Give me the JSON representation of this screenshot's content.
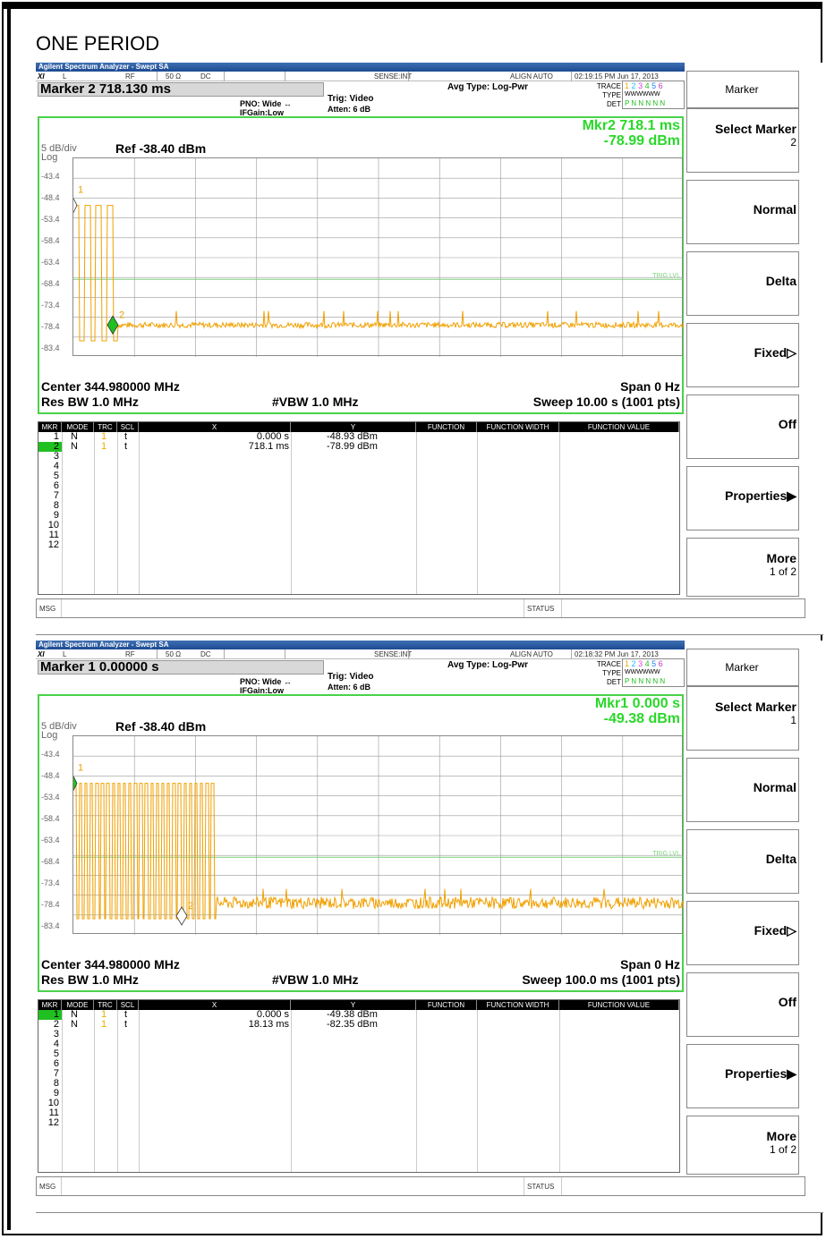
{
  "page_title": "ONE PERIOD",
  "screens": [
    {
      "titlebar": "Agilent Spectrum Analyzer - Swept SA",
      "status": {
        "l": "L",
        "rf": "RF",
        "ohm": "50 Ω",
        "dc": "DC",
        "sense": "SENSE:INT",
        "align": "ALIGN AUTO",
        "datetime": "02:19:15 PM Jun 17, 2013"
      },
      "marker_header": "Marker 2 718.130 ms",
      "avg_type": "Avg Type: Log-Pwr",
      "pno": "PNO: Wide ↔",
      "ifgain": "IFGain:Low",
      "trig": "Trig: Video",
      "atten": "Atten: 6 dB",
      "trace_label": "TRACE",
      "type_label": "TYPE",
      "det_label": "DET",
      "trace_numbers": [
        "1",
        "2",
        "3",
        "4",
        "5",
        "6"
      ],
      "type_values": "WWWWWW",
      "det_values": "P N N N N N",
      "mkr_readout_line1": "Mkr2 718.1 ms",
      "mkr_readout_line2": "-78.99 dBm",
      "scale_div": "5 dB/div",
      "scale_type": "Log",
      "ref_level": "Ref -38.40 dBm",
      "y_ticks": [
        "-43.4",
        "-48.4",
        "-53.4",
        "-58.4",
        "-63.4",
        "-68.4",
        "-73.4",
        "-78.4",
        "-83.4"
      ],
      "trig_lvl": "TRIG LVL",
      "center": "Center 344.980000 MHz",
      "res_bw": "Res BW 1.0 MHz",
      "vbw": "#VBW 1.0 MHz",
      "span": "Span 0 Hz",
      "sweep": "Sweep  10.00 s (1001 pts)",
      "markers_on_plot": [
        {
          "label": "1"
        },
        {
          "label": "2"
        }
      ],
      "table_headers": [
        "MKR",
        "MODE",
        "TRC",
        "SCL",
        "X",
        "Y",
        "FUNCTION",
        "FUNCTION WIDTH",
        "FUNCTION VALUE"
      ],
      "table_rows": [
        {
          "mkr": "1",
          "mode": "N",
          "trc": "1",
          "scl": "t",
          "x": "0.000 s",
          "y": "-48.93 dBm"
        },
        {
          "mkr": "2",
          "mode": "N",
          "trc": "1",
          "scl": "t",
          "x": "718.1 ms",
          "y": "-78.99 dBm"
        },
        {
          "mkr": "3"
        },
        {
          "mkr": "4"
        },
        {
          "mkr": "5"
        },
        {
          "mkr": "6"
        },
        {
          "mkr": "7"
        },
        {
          "mkr": "8"
        },
        {
          "mkr": "9"
        },
        {
          "mkr": "10"
        },
        {
          "mkr": "11"
        },
        {
          "mkr": "12"
        }
      ],
      "active_marker_row": 1,
      "msg": "MSG",
      "status_label": "STATUS",
      "softkeys": {
        "title": "Marker",
        "select": "Select Marker",
        "select_sub": "2",
        "normal": "Normal",
        "delta": "Delta",
        "fixed": "Fixed▷",
        "off": "Off",
        "properties": "Properties▶",
        "more": "More",
        "more_sub": "1 of 2"
      }
    },
    {
      "titlebar": "Agilent Spectrum Analyzer - Swept SA",
      "status": {
        "l": "L",
        "rf": "RF",
        "ohm": "50 Ω",
        "dc": "DC",
        "sense": "SENSE:INT",
        "align": "ALIGN AUTO",
        "datetime": "02:18:32 PM Jun 17, 2013"
      },
      "marker_header": "Marker 1 0.00000 s",
      "avg_type": "Avg Type: Log-Pwr",
      "pno": "PNO: Wide ↔",
      "ifgain": "IFGain:Low",
      "trig": "Trig: Video",
      "atten": "Atten: 6 dB",
      "trace_label": "TRACE",
      "type_label": "TYPE",
      "det_label": "DET",
      "trace_numbers": [
        "1",
        "2",
        "3",
        "4",
        "5",
        "6"
      ],
      "type_values": "WWWWWW",
      "det_values": "P N N N N N",
      "mkr_readout_line1": "Mkr1 0.000 s",
      "mkr_readout_line2": "-49.38 dBm",
      "scale_div": "5 dB/div",
      "scale_type": "Log",
      "ref_level": "Ref -38.40 dBm",
      "y_ticks": [
        "-43.4",
        "-48.4",
        "-53.4",
        "-58.4",
        "-63.4",
        "-68.4",
        "-73.4",
        "-78.4",
        "-83.4"
      ],
      "trig_lvl": "TRIG LVL",
      "center": "Center 344.980000 MHz",
      "res_bw": "Res BW 1.0 MHz",
      "vbw": "#VBW 1.0 MHz",
      "span": "Span 0 Hz",
      "sweep": "Sweep  100.0 ms (1001 pts)",
      "markers_on_plot": [
        {
          "label": "1"
        },
        {
          "label": "2"
        }
      ],
      "table_headers": [
        "MKR",
        "MODE",
        "TRC",
        "SCL",
        "X",
        "Y",
        "FUNCTION",
        "FUNCTION WIDTH",
        "FUNCTION VALUE"
      ],
      "table_rows": [
        {
          "mkr": "1",
          "mode": "N",
          "trc": "1",
          "scl": "t",
          "x": "0.000 s",
          "y": "-49.38 dBm"
        },
        {
          "mkr": "2",
          "mode": "N",
          "trc": "1",
          "scl": "t",
          "x": "18.13 ms",
          "y": "-82.35 dBm"
        },
        {
          "mkr": "3"
        },
        {
          "mkr": "4"
        },
        {
          "mkr": "5"
        },
        {
          "mkr": "6"
        },
        {
          "mkr": "7"
        },
        {
          "mkr": "8"
        },
        {
          "mkr": "9"
        },
        {
          "mkr": "10"
        },
        {
          "mkr": "11"
        },
        {
          "mkr": "12"
        }
      ],
      "active_marker_row": 0,
      "msg": "MSG",
      "status_label": "STATUS",
      "softkeys": {
        "title": "Marker",
        "select": "Select Marker",
        "select_sub": "1",
        "normal": "Normal",
        "delta": "Delta",
        "fixed": "Fixed▷",
        "off": "Off",
        "properties": "Properties▶",
        "more": "More",
        "more_sub": "1 of 2"
      }
    }
  ],
  "colors": {
    "trace": "#f0a000",
    "graticule_border": "#4ad24a",
    "readout": "#2ad82a",
    "marker_active": "#20c020",
    "trig_line": "#7fd07f"
  }
}
